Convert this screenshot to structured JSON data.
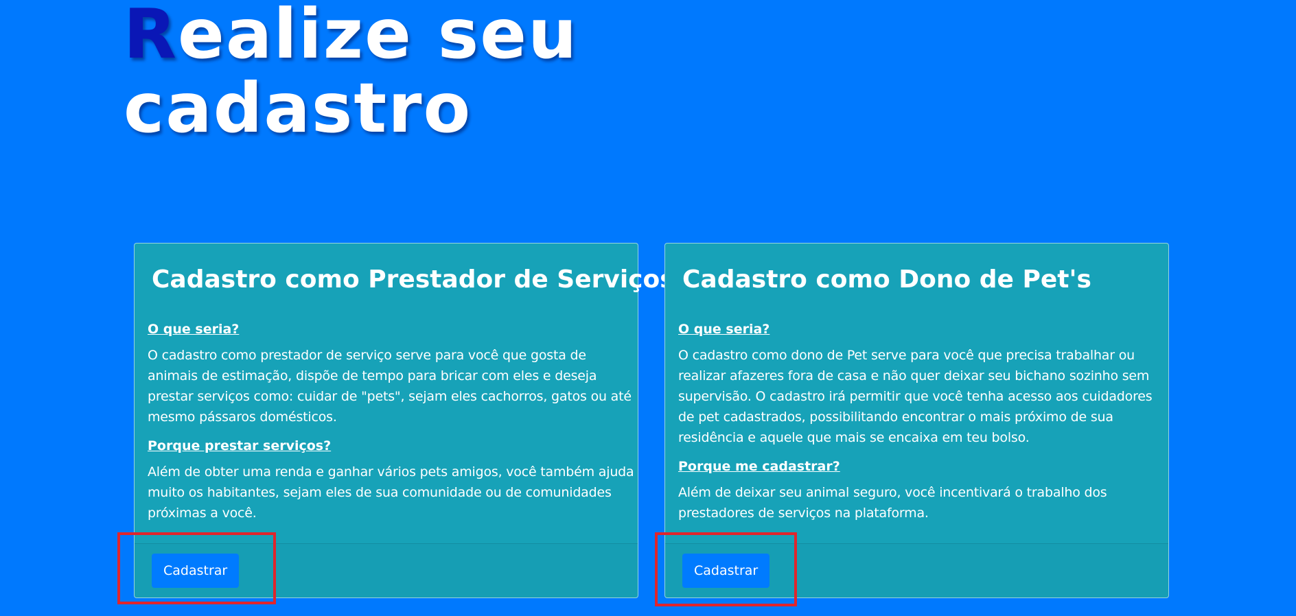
{
  "hero": {
    "title_initial": "R",
    "title_rest": "ealize seu cadastro"
  },
  "cards": [
    {
      "title": "Cadastro como Prestador de Serviços",
      "q1": "O que seria?",
      "t1": "O cadastro como prestador de serviço serve para você que gosta de animais de estimação, dispõe de tempo para bricar com eles e deseja prestar serviços como: cuidar de \"pets\", sejam eles cachorros, gatos ou até mesmo pássaros domésticos.",
      "q2": "Porque prestar serviços?",
      "t2": "Além de obter uma renda e ganhar vários pets amigos, você também ajuda muito os habitantes, sejam eles de sua comunidade ou de comunidades próximas a você.",
      "button": "Cadastrar"
    },
    {
      "title": "Cadastro como Dono de Pet's",
      "q1": "O que seria?",
      "t1": "O cadastro como dono de Pet serve para você que precisa trabalhar ou realizar afazeres fora de casa e não quer deixar seu bichano sozinho sem supervisão. O cadastro irá permitir que você tenha acesso aos cuidadores de pet cadastrados, possibilitando encontrar o mais próximo de sua residência e aquele que mais se encaixa em teu bolso.",
      "q2": "Porque me cadastrar?",
      "t2": "Além de deixar seu animal seguro, você incentivará o trabalho dos prestadores de serviços na plataforma.",
      "button": "Cadastrar"
    }
  ],
  "colors": {
    "background": "#0079fe",
    "card": "#17a2b8",
    "button": "#007bff",
    "title_initial": "#0a17b6",
    "highlight": "#e0252c"
  }
}
